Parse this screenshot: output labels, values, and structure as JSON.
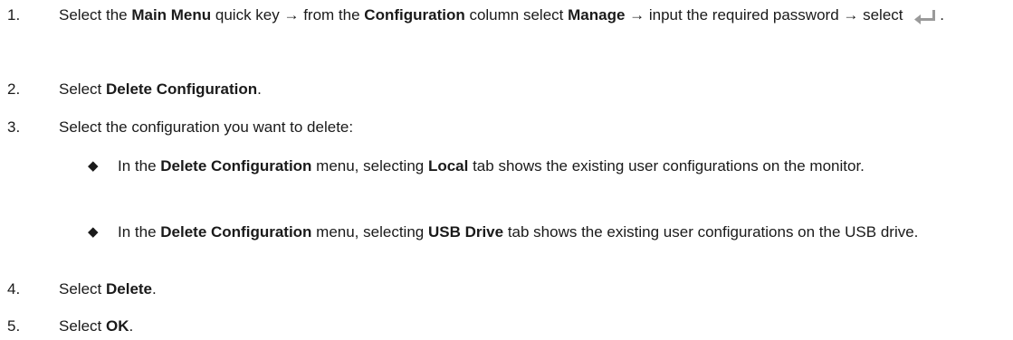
{
  "steps": [
    {
      "num": "1.",
      "parts": [
        {
          "t": "Select the "
        },
        {
          "b": "Main Menu"
        },
        {
          "t": " quick key → from the "
        },
        {
          "b": "Configuration"
        },
        {
          "t": " column select "
        },
        {
          "b": "Manage"
        },
        {
          "t": " → input the required password → select "
        },
        {
          "icon": "enter-icon"
        },
        {
          "t": "."
        }
      ]
    },
    {
      "num": "2.",
      "parts": [
        {
          "t": "Select "
        },
        {
          "b": "Delete Configuration"
        },
        {
          "t": "."
        }
      ]
    },
    {
      "num": "3.",
      "parts": [
        {
          "t": "Select the configuration you want to delete:"
        }
      ]
    },
    {
      "num": "4.",
      "parts": [
        {
          "t": "Select "
        },
        {
          "b": "Delete"
        },
        {
          "t": "."
        }
      ]
    },
    {
      "num": "5.",
      "parts": [
        {
          "t": "Select "
        },
        {
          "b": "OK"
        },
        {
          "t": "."
        }
      ]
    }
  ],
  "substeps": [
    {
      "bullet": "◆",
      "parts": [
        {
          "t": "In the "
        },
        {
          "b": "Delete Configuration"
        },
        {
          "t": " menu, selecting "
        },
        {
          "b": "Local"
        },
        {
          "t": " tab shows the existing user configurations on the monitor."
        }
      ]
    },
    {
      "bullet": "◆",
      "parts": [
        {
          "t": "In the "
        },
        {
          "b": "Delete Configuration"
        },
        {
          "t": " menu, selecting "
        },
        {
          "b": "USB Drive"
        },
        {
          "t": " tab shows the existing user configurations on the USB drive."
        }
      ]
    }
  ],
  "colors": {
    "text": "#1a1a1a",
    "icon": "#9a9a9a"
  }
}
